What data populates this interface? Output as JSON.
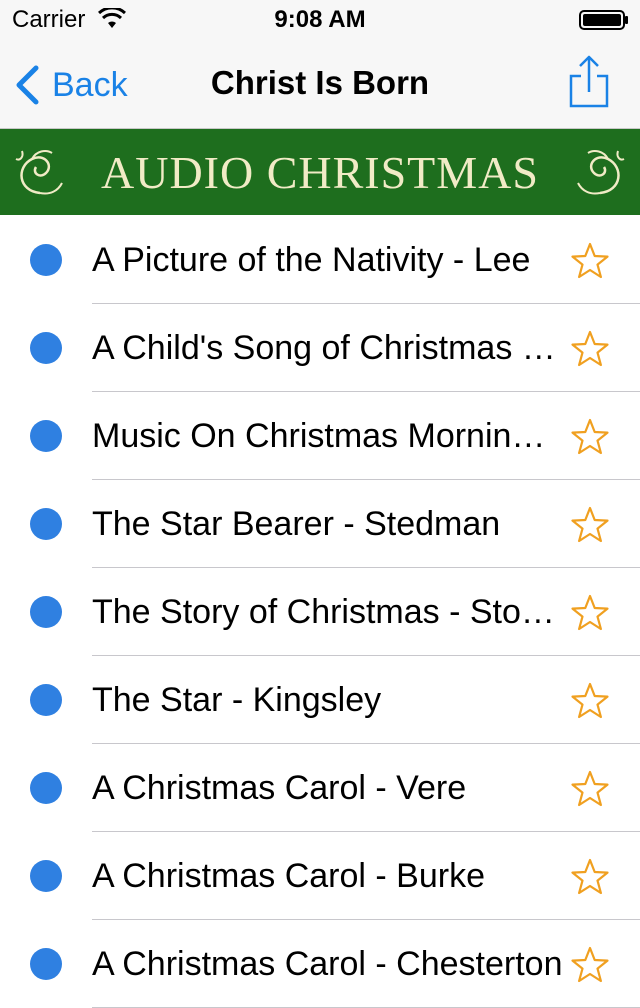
{
  "status_bar": {
    "carrier": "Carrier",
    "time": "9:08 AM",
    "wifi_icon": "wifi-icon",
    "battery_icon": "battery-icon"
  },
  "nav": {
    "back_label": "Back",
    "title": "Christ Is Born",
    "share_icon": "share-icon",
    "tint": "#1a82e6"
  },
  "banner": {
    "text": "AUDIO CHRISTMAS",
    "background": "#1e6e1e",
    "text_color": "#f1ebc6"
  },
  "list": {
    "items": [
      {
        "title": "A Picture of the Nativity - Lee"
      },
      {
        "title": "A Child's Song of Christmas - Pickthall"
      },
      {
        "title": "Music On Christmas Morning - Bronte"
      },
      {
        "title": "The Star Bearer - Stedman"
      },
      {
        "title": "The Story of Christmas - Stoddard"
      },
      {
        "title": "The Star - Kingsley"
      },
      {
        "title": "A Christmas Carol - Vere"
      },
      {
        "title": "A Christmas Carol - Burke"
      },
      {
        "title": "A Christmas Carol - Chesterton"
      }
    ],
    "dot_color": "#2f80e1",
    "star_color": "#f0a020"
  }
}
